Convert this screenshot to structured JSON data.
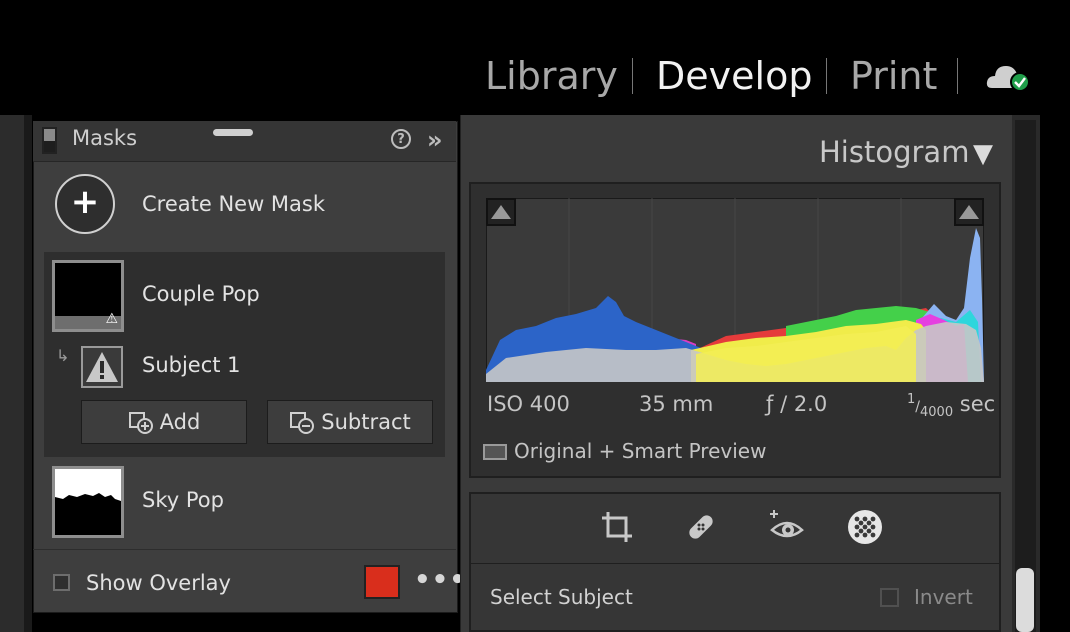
{
  "modules": {
    "library": "Library",
    "develop": "Develop",
    "print": "Print"
  },
  "masks_panel": {
    "title": "Masks",
    "create_label": "Create New Mask",
    "masks": [
      {
        "name": "Couple Pop"
      },
      {
        "name": "Sky Pop"
      }
    ],
    "component_name": "Subject 1",
    "add_label": "Add",
    "subtract_label": "Subtract",
    "overlay_label": "Show Overlay",
    "overlay_color": "#d92e1c"
  },
  "histogram": {
    "title": "Histogram",
    "iso": "ISO 400",
    "focal": "35 mm",
    "aperture": "ƒ / 2.0",
    "shutter_num": "1",
    "shutter_den": "4000",
    "shutter_unit": "sec",
    "preview": "Original + Smart Preview"
  },
  "mask_tool": {
    "title": "Select Subject",
    "invert_label": "Invert"
  },
  "icons": [
    "cloud-sync-icon",
    "help-icon",
    "collapse-icon",
    "plus-icon",
    "warning-icon",
    "add-mask-icon",
    "subtract-mask-icon",
    "crop-icon",
    "healing-icon",
    "redeye-icon",
    "masking-icon"
  ]
}
